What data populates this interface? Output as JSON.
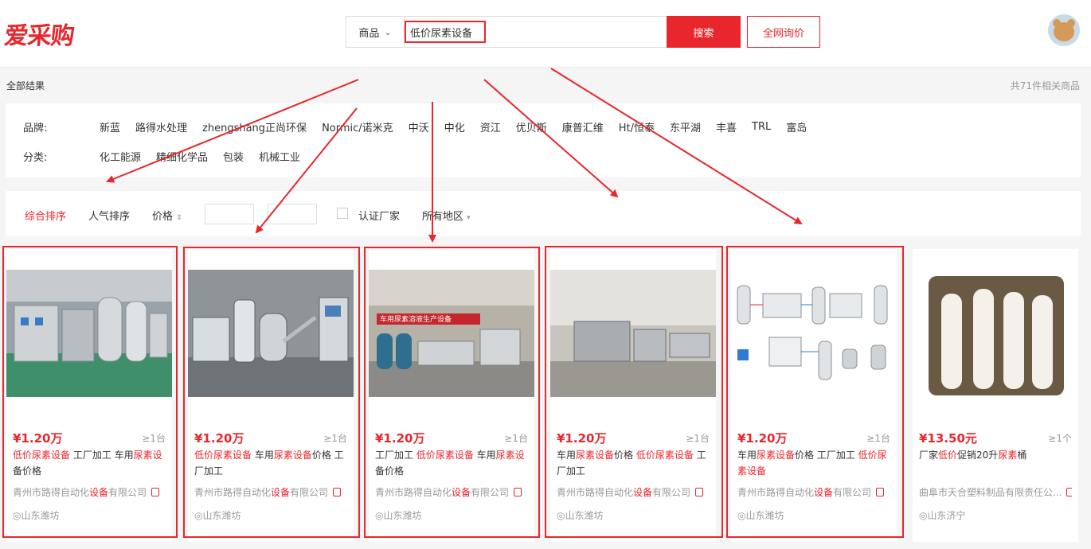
{
  "header": {
    "logo": "爱采购",
    "category": "商品",
    "search_value": "低价尿素设备",
    "search_button": "搜索",
    "quote_button": "全网询价"
  },
  "results": {
    "label": "全部结果",
    "count": "共71件相关商品"
  },
  "filters": {
    "brand_label": "品牌:",
    "brands": [
      "新蓝",
      "路得水处理",
      "zhengshang正尚环保",
      "Normic/诺米克",
      "中沃",
      "中化",
      "资江",
      "优贝斯",
      "康普汇维",
      "Ht/恒泰",
      "东平湖",
      "丰喜",
      "TRL",
      "富岛"
    ],
    "category_label": "分类:",
    "categories": [
      "化工能源",
      "精细化学品",
      "包装",
      "机械工业"
    ]
  },
  "sort": {
    "comprehensive": "综合排序",
    "popularity": "人气排序",
    "price": "价格",
    "price_icon": "sort-arrows-icon",
    "certified": "认证厂家",
    "region": "所有地区"
  },
  "products": [
    {
      "price": "¥1.20万",
      "moq": "≥1台",
      "company_pre": "青州市路得自动化",
      "company_hl": "设备",
      "company_post": "有限公司",
      "location": "山东潍坊",
      "title": [
        {
          "t": "低价尿素设备",
          "h": true
        },
        {
          "t": " 工厂加工 车用",
          "h": false
        },
        {
          "t": "尿素设",
          "h": true
        },
        {
          "t": "备价格",
          "h": false
        }
      ]
    },
    {
      "price": "¥1.20万",
      "moq": "≥1台",
      "company_pre": "青州市路得自动化",
      "company_hl": "设备",
      "company_post": "有限公司",
      "location": "山东潍坊",
      "title": [
        {
          "t": "低价尿素设备",
          "h": true
        },
        {
          "t": " 车用",
          "h": false
        },
        {
          "t": "尿素设备",
          "h": true
        },
        {
          "t": "价格 工厂加工",
          "h": false
        }
      ]
    },
    {
      "price": "¥1.20万",
      "moq": "≥1台",
      "company_pre": "青州市路得自动化",
      "company_hl": "设备",
      "company_post": "有限公司",
      "location": "山东潍坊",
      "title": [
        {
          "t": "工厂加工 ",
          "h": false
        },
        {
          "t": "低价尿素设备",
          "h": true
        },
        {
          "t": " 车用",
          "h": false
        },
        {
          "t": "尿素设",
          "h": true
        },
        {
          "t": "备价格",
          "h": false
        }
      ]
    },
    {
      "price": "¥1.20万",
      "moq": "≥1台",
      "company_pre": "青州市路得自动化",
      "company_hl": "设备",
      "company_post": "有限公司",
      "location": "山东潍坊",
      "title": [
        {
          "t": "车用",
          "h": false
        },
        {
          "t": "尿素设备",
          "h": true
        },
        {
          "t": "价格 ",
          "h": false
        },
        {
          "t": "低价尿素设备",
          "h": true
        },
        {
          "t": " 工厂加工",
          "h": false
        }
      ]
    },
    {
      "price": "¥1.20万",
      "moq": "≥1台",
      "company_pre": "青州市路得自动化",
      "company_hl": "设备",
      "company_post": "有限公司",
      "location": "山东潍坊",
      "title": [
        {
          "t": "车用",
          "h": false
        },
        {
          "t": "尿素设备",
          "h": true
        },
        {
          "t": "价格 工厂加工 ",
          "h": false
        },
        {
          "t": "低价尿素设备",
          "h": true
        }
      ]
    },
    {
      "price": "¥13.50元",
      "moq": "≥1个",
      "company_pre": "曲阜市天合塑料制品有限责任公...",
      "company_hl": "",
      "company_post": "",
      "location": "山东济宁",
      "title": [
        {
          "t": "厂家",
          "h": false
        },
        {
          "t": "低价",
          "h": true
        },
        {
          "t": "促销20升",
          "h": false
        },
        {
          "t": "尿素",
          "h": true
        },
        {
          "t": "桶",
          "h": false
        }
      ]
    }
  ],
  "image_labels": {
    "banner_text": "车用尿素溶液生产设备"
  }
}
